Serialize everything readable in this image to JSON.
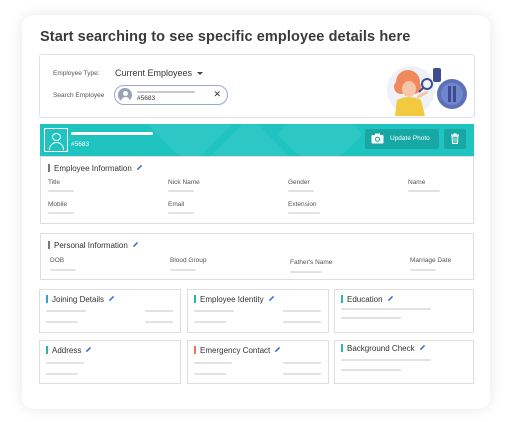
{
  "page_title": "Start searching to see specific employee details here",
  "search": {
    "employee_type_label": "Employee Type:",
    "employee_type_value": "Current Employees",
    "search_label": "Search Employee",
    "search_value": "#5683",
    "clear_icon": "close-icon"
  },
  "header": {
    "employee_id": "#5683",
    "update_photo_label": "Update Photo",
    "camera_icon": "camera-icon",
    "delete_icon": "trash-icon",
    "background_color": "#1fc4c0",
    "button_color": "#17a8a5"
  },
  "employee_info": {
    "title": "Employee Information",
    "accent": "#777777",
    "fields": [
      "Title",
      "Nick Name",
      "Gender",
      "Name",
      "Mobile",
      "Email",
      "Extension"
    ]
  },
  "personal_info": {
    "title": "Personal Information",
    "accent": "#777777",
    "fields": [
      "DOB",
      "Blood Group",
      "Father's Name",
      "Marriage Date"
    ]
  },
  "sections": {
    "joining": {
      "title": "Joining Details",
      "accent": "#3a9fd6"
    },
    "identity": {
      "title": "Employee Identity",
      "accent": "#2bb5a8"
    },
    "education": {
      "title": "Education",
      "accent": "#2bb5a8"
    },
    "address": {
      "title": "Address",
      "accent": "#2bb5a8"
    },
    "emergency": {
      "title": "Emergency Contact",
      "accent": "#e8765c"
    },
    "background": {
      "title": "Background Check",
      "accent": "#2bb5a8"
    }
  },
  "edit_icon": "pencil-icon"
}
